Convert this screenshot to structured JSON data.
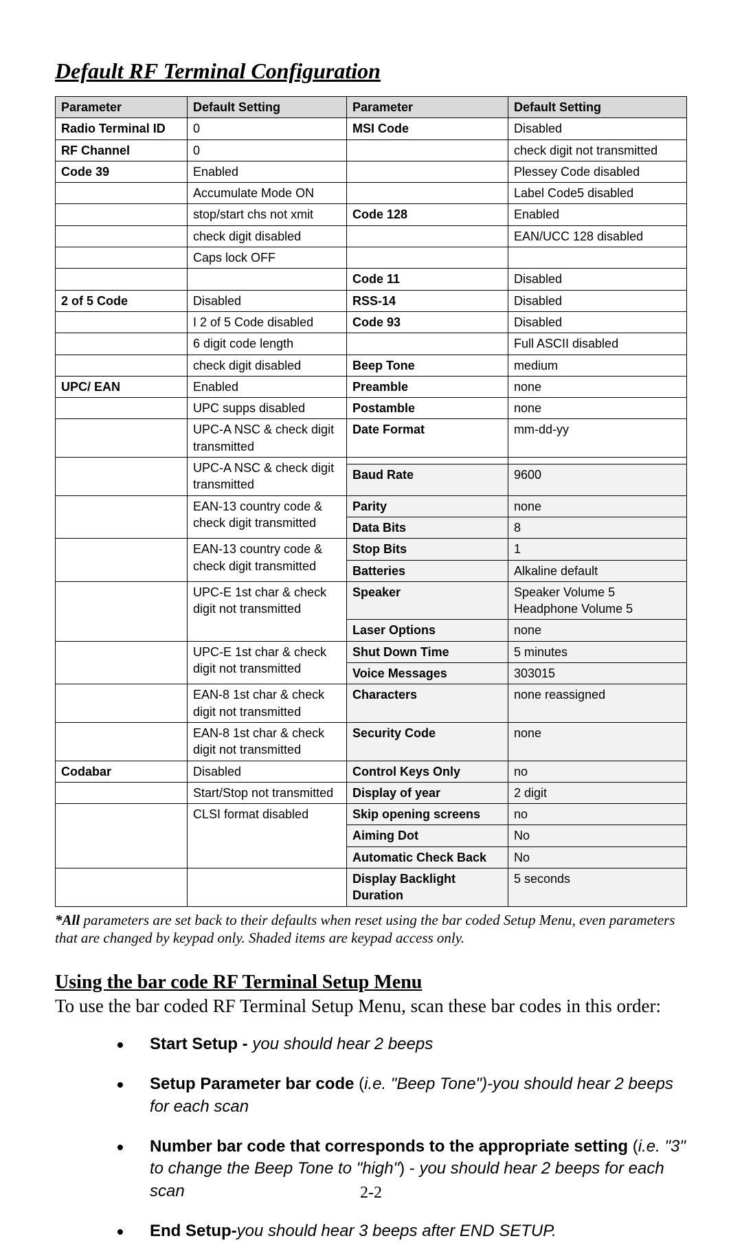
{
  "title": "Default RF Terminal Configuration",
  "headers": {
    "param": "Parameter",
    "def": "Default Setting"
  },
  "leftRows": [
    {
      "p": "Radio Terminal ID",
      "pb": true,
      "d": "0"
    },
    {
      "p": "RF Channel",
      "pb": true,
      "d": "0"
    },
    {
      "p": "Code 39",
      "pb": true,
      "d": "Enabled"
    },
    {
      "p": "",
      "d": "Accumulate Mode ON"
    },
    {
      "p": "",
      "d": "stop/start chs not xmit"
    },
    {
      "p": "",
      "d": "check digit disabled"
    },
    {
      "p": "",
      "d": "Caps lock OFF"
    },
    {
      "p": "",
      "d": ""
    },
    {
      "p": "2 of 5 Code",
      "pb": true,
      "d": "Disabled"
    },
    {
      "p": "",
      "d": "I 2 of 5 Code disabled"
    },
    {
      "p": "",
      "d": "6 digit code length"
    },
    {
      "p": "",
      "d": "check digit disabled"
    },
    {
      "p": "UPC/ EAN",
      "pb": true,
      "d": "Enabled"
    },
    {
      "p": "",
      "d": "UPC supps disabled"
    },
    {
      "p": "",
      "d": "UPC-A NSC & check digit transmitted"
    },
    {
      "p": "",
      "d": "UPC-A NSC & check digit transmitted",
      "h": 2
    },
    {
      "p": "",
      "d": "EAN-13 country code & check digit transmitted",
      "h": 2
    },
    {
      "p": "",
      "d": "EAN-13 country code & check digit transmitted",
      "h": 2
    },
    {
      "p": "",
      "d": "UPC-E 1st char & check digit not transmitted",
      "h": 2
    },
    {
      "p": "",
      "d": "UPC-E 1st char & check digit not transmitted",
      "h": 2
    },
    {
      "p": "",
      "d": "EAN-8 1st char & check digit not transmitted"
    },
    {
      "p": "",
      "d": "EAN-8 1st char & check digit not transmitted"
    },
    {
      "p": "Codabar",
      "pb": true,
      "d": "Disabled"
    },
    {
      "p": "",
      "d": "Start/Stop not transmitted"
    },
    {
      "p": "",
      "d": "CLSI format disabled",
      "h": 3
    }
  ],
  "rightRows": [
    {
      "p": "MSI Code",
      "pb": true,
      "d": "Disabled"
    },
    {
      "p": "",
      "d": "check digit not transmitted"
    },
    {
      "p": "",
      "d": "Plessey Code disabled"
    },
    {
      "p": "",
      "d": "Label Code5 disabled"
    },
    {
      "p": "Code 128",
      "pb": true,
      "d": "Enabled"
    },
    {
      "p": "",
      "d": "EAN/UCC 128 disabled"
    },
    {
      "p": "",
      "d": ""
    },
    {
      "p": "Code 11",
      "pb": true,
      "d": "Disabled"
    },
    {
      "p": "RSS-14",
      "pb": true,
      "d": "Disabled"
    },
    {
      "p": "Code 93",
      "pb": true,
      "d": "Disabled"
    },
    {
      "p": "",
      "d": "Full ASCII disabled"
    },
    {
      "p": "Beep Tone",
      "pb": true,
      "d": "medium"
    },
    {
      "p": "Preamble",
      "pb": true,
      "d": "none"
    },
    {
      "p": "Postamble",
      "pb": true,
      "d": "none"
    },
    {
      "p": "Date Format",
      "pb": true,
      "d": "mm-dd-yy"
    },
    {
      "p": "",
      "d": ""
    },
    {
      "p": "Baud Rate",
      "pb": true,
      "d": "9600",
      "sh": true
    },
    {
      "p": "Parity",
      "pb": true,
      "d": "none",
      "sh": true
    },
    {
      "p": "Data Bits",
      "pb": true,
      "d": "8",
      "sh": true
    },
    {
      "p": "Stop Bits",
      "pb": true,
      "d": "1",
      "sh": true
    },
    {
      "p": "Batteries",
      "pb": true,
      "d": "Alkaline default",
      "sh": true
    },
    {
      "p": "Speaker",
      "pb": true,
      "d": "Speaker Volume 5 Headphone Volume 5",
      "sh": true
    },
    {
      "p": "Laser Options",
      "pb": true,
      "d": "none",
      "sh": true
    },
    {
      "p": "Shut Down Time",
      "pb": true,
      "d": "5 minutes",
      "sh": true
    },
    {
      "p": "Voice Messages",
      "pb": true,
      "d": "303015",
      "sh": true
    },
    {
      "p": "Characters",
      "pb": true,
      "d": "none reassigned",
      "sh": true
    },
    {
      "p": "Security Code",
      "pb": true,
      "d": "none",
      "sh": true
    },
    {
      "p": "Control Keys Only",
      "pb": true,
      "d": "no",
      "sh": true
    },
    {
      "p": "Display of year",
      "pb": true,
      "d": "2 digit",
      "sh": true
    },
    {
      "p": "Skip opening screens",
      "pb": true,
      "d": "no",
      "sh": true
    },
    {
      "p": "Aiming Dot",
      "pb": true,
      "d": "No",
      "sh": true
    },
    {
      "p": "Automatic Check Back",
      "pb": true,
      "d": "No",
      "sh": true
    },
    {
      "p": "Display Backlight Duration",
      "pb": true,
      "d": "5 seconds",
      "sh": true
    }
  ],
  "footnote": {
    "lead": "*All",
    "rest": " parameters are set back to their defaults when reset using the bar coded Setup Menu, even parameters that are changed by keypad only. Shaded items are keypad access only."
  },
  "subTitle": "Using the bar code RF Terminal Setup Menu",
  "bodyText": "To use the bar coded RF Terminal Setup Menu, scan these bar codes in this order:",
  "steps": [
    {
      "bold": "Start Setup - ",
      "italic": "you should hear 2 beeps"
    },
    {
      "bold": "Setup Parameter bar code ",
      "plain": "(",
      "italic": "i.e. \"Beep Tone\")-you should hear 2 beeps for each scan"
    },
    {
      "bold": "Number bar code that corresponds to the appropriate setting ",
      "plain": "(",
      "italic": "i.e. \"3\" to change the Beep Tone to \"high\"",
      "plain2": ") - ",
      "italic2": "you should hear 2 beeps for each scan"
    },
    {
      "bold": "End Setup-",
      "italic": "you should hear 3 beeps after END SETUP."
    }
  ],
  "pageNumber": "2-2"
}
